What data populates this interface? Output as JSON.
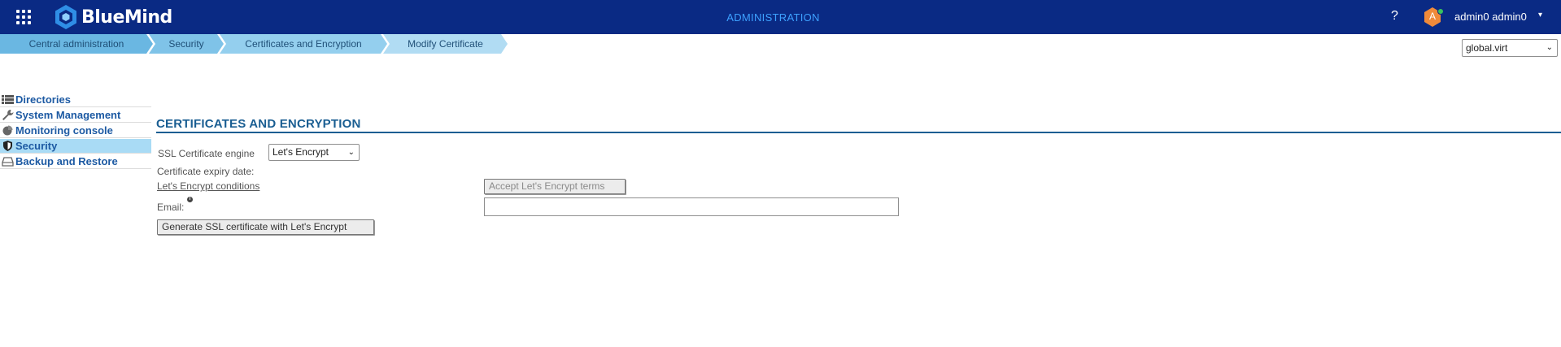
{
  "header": {
    "app_name": "BlueMind",
    "section_title": "ADMINISTRATION",
    "help_label": "?",
    "user_initial": "A",
    "user_name": "admin0 admin0",
    "user_caret": "▾",
    "colors": {
      "bar": "#0a2a84",
      "title": "#3da1ff",
      "avatar": "#f08a3a",
      "presence": "#37c35e"
    }
  },
  "breadcrumb": [
    {
      "label": "Central administration"
    },
    {
      "label": "Security"
    },
    {
      "label": "Certificates and Encryption"
    },
    {
      "label": "Modify Certificate"
    }
  ],
  "domain_select": {
    "value": "global.virt",
    "caret": "⌄"
  },
  "sidebar": {
    "items": [
      {
        "label": "Directories",
        "icon": "list-icon",
        "active": false
      },
      {
        "label": "System Management",
        "icon": "wrench-icon",
        "active": false
      },
      {
        "label": "Monitoring console",
        "icon": "pie-chart-icon",
        "active": false
      },
      {
        "label": "Security",
        "icon": "shield-icon",
        "active": true
      },
      {
        "label": "Backup and Restore",
        "icon": "drive-icon",
        "active": false
      }
    ]
  },
  "main": {
    "title": "CERTIFICATES AND ENCRYPTION",
    "engine_label": "SSL Certificate engine",
    "engine_value": "Let's Encrypt",
    "engine_caret": "⌄",
    "expiry_label": "Certificate expiry date:",
    "conditions_link": "Let's Encrypt conditions",
    "accept_button": "Accept Let's Encrypt terms",
    "email_label": "Email:",
    "email_info": "i",
    "email_value": "",
    "generate_button": "Generate SSL certificate with Let's Encrypt"
  }
}
